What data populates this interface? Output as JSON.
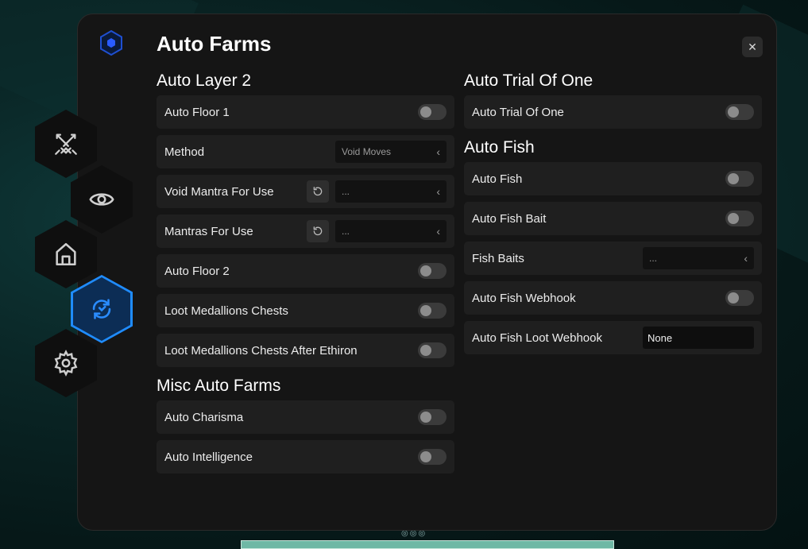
{
  "header": {
    "title": "Auto Farms",
    "close_glyph": "✕"
  },
  "sidebar": {
    "items": [
      {
        "icon": "swords-icon"
      },
      {
        "icon": "eye-icon"
      },
      {
        "icon": "home-icon"
      },
      {
        "icon": "refresh-cycle-icon",
        "active": true
      },
      {
        "icon": "gear-icon"
      }
    ]
  },
  "left": {
    "layer2_title": "Auto Layer 2",
    "auto_floor_1": "Auto Floor 1",
    "method_label": "Method",
    "method_value": "Void Moves",
    "void_mantra_label": "Void Mantra For Use",
    "void_mantra_value": "...",
    "mantras_label": "Mantras For Use",
    "mantras_value": "...",
    "auto_floor_2": "Auto Floor 2",
    "loot_medallions": "Loot Medallions Chests",
    "loot_medallions_after": "Loot Medallions Chests After Ethiron",
    "misc_title": "Misc Auto Farms",
    "auto_charisma": "Auto Charisma",
    "auto_intelligence": "Auto Intelligence"
  },
  "right": {
    "trial_title": "Auto Trial Of One",
    "auto_trial": "Auto Trial Of One",
    "fish_title": "Auto Fish",
    "auto_fish": "Auto Fish",
    "auto_fish_bait": "Auto Fish Bait",
    "fish_baits_label": "Fish Baits",
    "fish_baits_value": "...",
    "auto_fish_webhook": "Auto Fish Webhook",
    "loot_webhook_label": "Auto Fish Loot Webhook",
    "loot_webhook_value": "None"
  },
  "colors": {
    "accent": "#1f8cff",
    "panel": "#151515",
    "row": "#1f1f1f"
  }
}
